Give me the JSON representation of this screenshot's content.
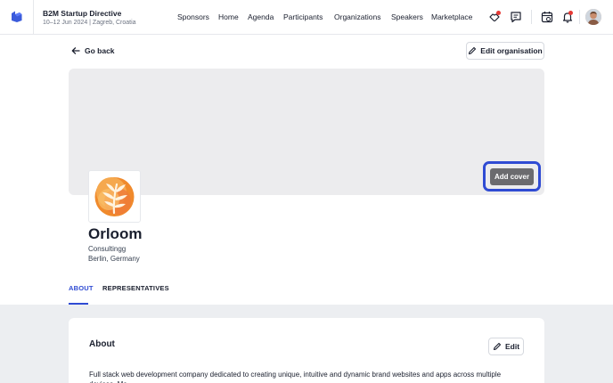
{
  "event": {
    "title": "B2M Startup Directive",
    "subtitle": "10–12 Jun 2024 | Zagreb, Croatia"
  },
  "nav": {
    "items": [
      "Sponsors",
      "Home",
      "Agenda",
      "Participants",
      "Organizations",
      "Speakers",
      "Marketplace"
    ]
  },
  "toolbar": {
    "go_back": "Go back",
    "edit_organisation": "Edit organisation"
  },
  "cover": {
    "add_cover_label": "Add cover"
  },
  "organization": {
    "name": "Orloom",
    "category": "Consultingg",
    "location": "Berlin, Germany"
  },
  "tabs": [
    "ABOUT",
    "REPRESENTATIVES"
  ],
  "about": {
    "heading": "About",
    "edit_label": "Edit",
    "description": "Full stack web development company dedicated to creating unique, intuitive and dynamic brand websites and apps across multiple devices. Me"
  },
  "colors": {
    "accent": "#2f4bd3",
    "brand": "#3b5bdb",
    "notification": "#e53935",
    "cover_button": "#6b6b6e"
  },
  "icons": [
    "logo-icon",
    "handshake-icon",
    "chat-icon",
    "calendar-icon",
    "bell-icon",
    "arrow-left-icon",
    "pencil-icon"
  ]
}
